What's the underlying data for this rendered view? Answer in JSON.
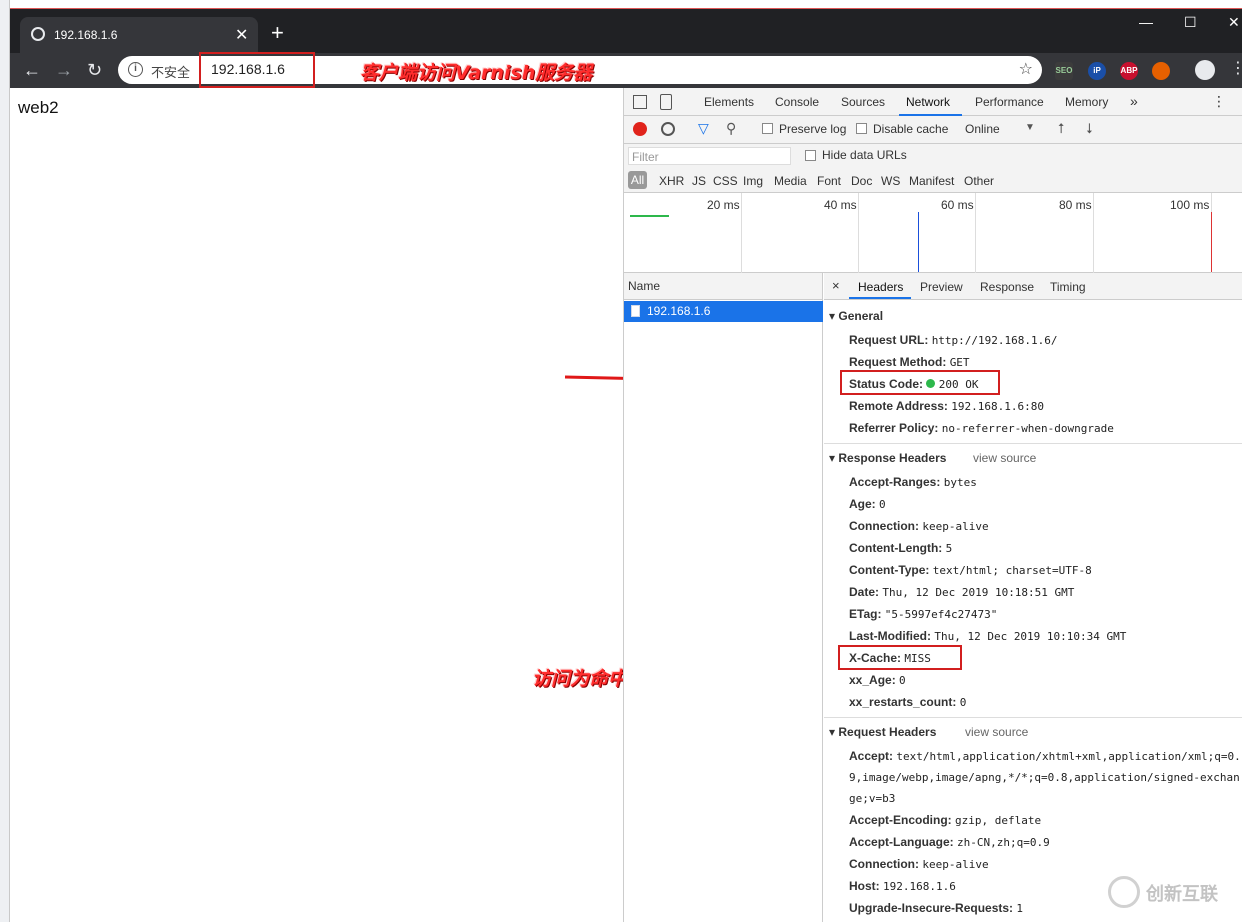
{
  "browser": {
    "tab_title": "192.168.1.6",
    "new_tab": "+",
    "window_controls": [
      "—",
      "☐",
      "✕"
    ],
    "address": {
      "insecure_label": "不安全",
      "url": "192.168.1.6"
    },
    "extensions": [
      "SEO",
      "iP",
      "ABP",
      "Firefox",
      "Account",
      "Menu"
    ]
  },
  "page": {
    "content": "web2"
  },
  "annotations": {
    "client_access": "客户端访问Varnish服务器",
    "cache_result": "访问为命中"
  },
  "devtools": {
    "tabs": [
      "Elements",
      "Console",
      "Sources",
      "Network",
      "Performance",
      "Memory",
      "»"
    ],
    "active_tab": "Network",
    "toolbar": {
      "preserve_log": "Preserve log",
      "disable_cache": "Disable cache",
      "throttle": "Online"
    },
    "filter": {
      "placeholder": "Filter",
      "hide_data_urls": "Hide data URLs"
    },
    "types": [
      "All",
      "XHR",
      "JS",
      "CSS",
      "Img",
      "Media",
      "Font",
      "Doc",
      "WS",
      "Manifest",
      "Other"
    ],
    "timeline_ticks": [
      "20 ms",
      "40 ms",
      "60 ms",
      "80 ms",
      "100 ms"
    ],
    "list": {
      "header": "Name",
      "items": [
        "192.168.1.6"
      ]
    },
    "detail_tabs": [
      "×",
      "Headers",
      "Preview",
      "Response",
      "Timing"
    ],
    "general": {
      "title": "General",
      "request_url_k": "Request URL:",
      "request_url_v": "http://192.168.1.6/",
      "method_k": "Request Method:",
      "method_v": "GET",
      "status_k": "Status Code:",
      "status_v": "200 OK",
      "remote_k": "Remote Address:",
      "remote_v": "192.168.1.6:80",
      "referrer_k": "Referrer Policy:",
      "referrer_v": "no-referrer-when-downgrade"
    },
    "response_headers": {
      "title": "Response Headers",
      "view_source": "view source",
      "items": [
        {
          "k": "Accept-Ranges:",
          "v": "bytes"
        },
        {
          "k": "Age:",
          "v": "0"
        },
        {
          "k": "Connection:",
          "v": "keep-alive"
        },
        {
          "k": "Content-Length:",
          "v": "5"
        },
        {
          "k": "Content-Type:",
          "v": "text/html; charset=UTF-8"
        },
        {
          "k": "Date:",
          "v": "Thu, 12 Dec 2019 10:18:51 GMT"
        },
        {
          "k": "ETag:",
          "v": "\"5-5997ef4c27473\""
        },
        {
          "k": "Last-Modified:",
          "v": "Thu, 12 Dec 2019 10:10:34 GMT"
        },
        {
          "k": "X-Cache:",
          "v": "MISS"
        },
        {
          "k": "xx_Age:",
          "v": "0"
        },
        {
          "k": "xx_restarts_count:",
          "v": "0"
        }
      ]
    },
    "request_headers": {
      "title": "Request Headers",
      "view_source": "view source",
      "accept_k": "Accept:",
      "accept_v1": "text/html,application/xhtml+xml,application/xml;q=0.",
      "accept_v2": "9,image/webp,image/apng,*/*;q=0.8,application/signed-exchan",
      "accept_v3": "ge;v=b3",
      "items": [
        {
          "k": "Accept-Encoding:",
          "v": "gzip, deflate"
        },
        {
          "k": "Accept-Language:",
          "v": "zh-CN,zh;q=0.9"
        },
        {
          "k": "Connection:",
          "v": "keep-alive"
        },
        {
          "k": "Host:",
          "v": "192.168.1.6"
        },
        {
          "k": "Upgrade-Insecure-Requests:",
          "v": "1"
        }
      ]
    }
  },
  "watermark": "创新互联",
  "colors": {
    "accent": "#1a73e8",
    "annotation": "#d21f1f",
    "status_ok": "#2db84b"
  }
}
